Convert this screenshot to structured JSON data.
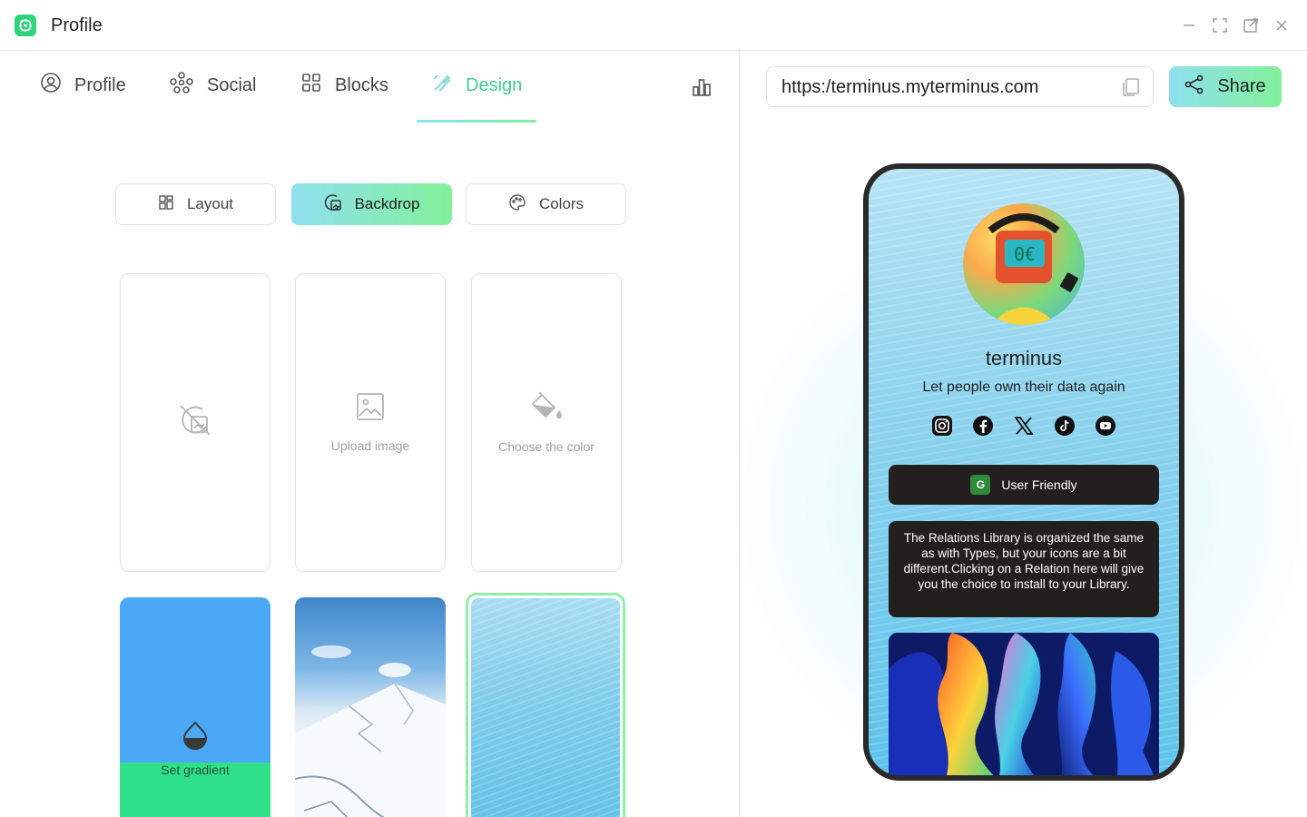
{
  "app": {
    "title": "Profile"
  },
  "tabs": [
    {
      "label": "Profile",
      "icon": "user-circle-icon"
    },
    {
      "label": "Social",
      "icon": "social-network-icon"
    },
    {
      "label": "Blocks",
      "icon": "grid-icon"
    },
    {
      "label": "Design",
      "icon": "brush-icon",
      "active": true
    }
  ],
  "design_modes": [
    {
      "label": "Layout",
      "icon": "layout-icon"
    },
    {
      "label": "Backdrop",
      "icon": "backdrop-icon",
      "active": true
    },
    {
      "label": "Colors",
      "icon": "palette-icon"
    }
  ],
  "backdrop_options": {
    "upload_label": "Upload image",
    "color_label": "Choose the color",
    "gradient_label": "Set gradient"
  },
  "preview": {
    "url": "https:/terminus.myterminus.com",
    "share_label": "Share",
    "name": "terminus",
    "bio": "Let people own their data again",
    "socials": [
      "instagram-icon",
      "facebook-icon",
      "x-icon",
      "tiktok-icon",
      "youtube-icon"
    ],
    "friendly_badge": "G",
    "friendly_label": "User Friendly",
    "text_block": "The Relations Library is organized the same as with Types, but your icons are a bit different.Clicking on a Relation here will give you the choice to install to your Library."
  },
  "colors": {
    "accent": "#3ecf8e",
    "gradient_start": "#8fe0f0",
    "gradient_end": "#82f09a",
    "card_dark": "#231f1e"
  }
}
